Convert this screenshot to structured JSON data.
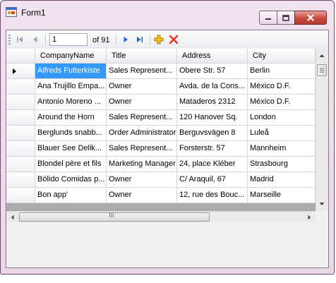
{
  "window": {
    "title": "Form1",
    "controls": {
      "minimize": "minimize",
      "maximize": "maximize",
      "close": "close"
    }
  },
  "navigator": {
    "position": "1",
    "count": "of 91",
    "icons": [
      "move-first-icon",
      "move-previous-icon",
      "move-next-icon",
      "move-last-icon",
      "add-new-icon",
      "delete-icon"
    ]
  },
  "grid": {
    "columns": [
      "CompanyName",
      "Title",
      "Address",
      "City"
    ],
    "selected_row": 0,
    "rows": [
      [
        "Alfreds Futterkiste",
        "Sales Represent...",
        "Obere Str. 57",
        "Berlin"
      ],
      [
        "Ana Trujillo Empa...",
        "Owner",
        "Avda. de la Cons...",
        "México D.F."
      ],
      [
        "Antonio Moreno ...",
        "Owner",
        "Mataderos  2312",
        "México D.F."
      ],
      [
        "Around the Horn",
        "Sales Represent...",
        "120 Hanover Sq.",
        "London"
      ],
      [
        "Berglunds snabb...",
        "Order Administrator",
        "Berguvsvägen  8",
        "Luleå"
      ],
      [
        "Blauer See Delik...",
        "Sales Represent...",
        "Forsterstr. 57",
        "Mannheim"
      ],
      [
        "Blondel père et fils",
        "Marketing Manager",
        "24, place Kléber",
        "Strasbourg"
      ],
      [
        "Bólido Comidas p...",
        "Owner",
        "C/ Araquil, 67",
        "Madrid"
      ],
      [
        "Bon app'",
        "Owner",
        "12, rue des Bouc...",
        "Marseille"
      ]
    ],
    "hscroll_grip": "III"
  },
  "colors": {
    "selection": "#3399ff",
    "close_button": "#c9493c",
    "grid_background": "#ababab"
  }
}
